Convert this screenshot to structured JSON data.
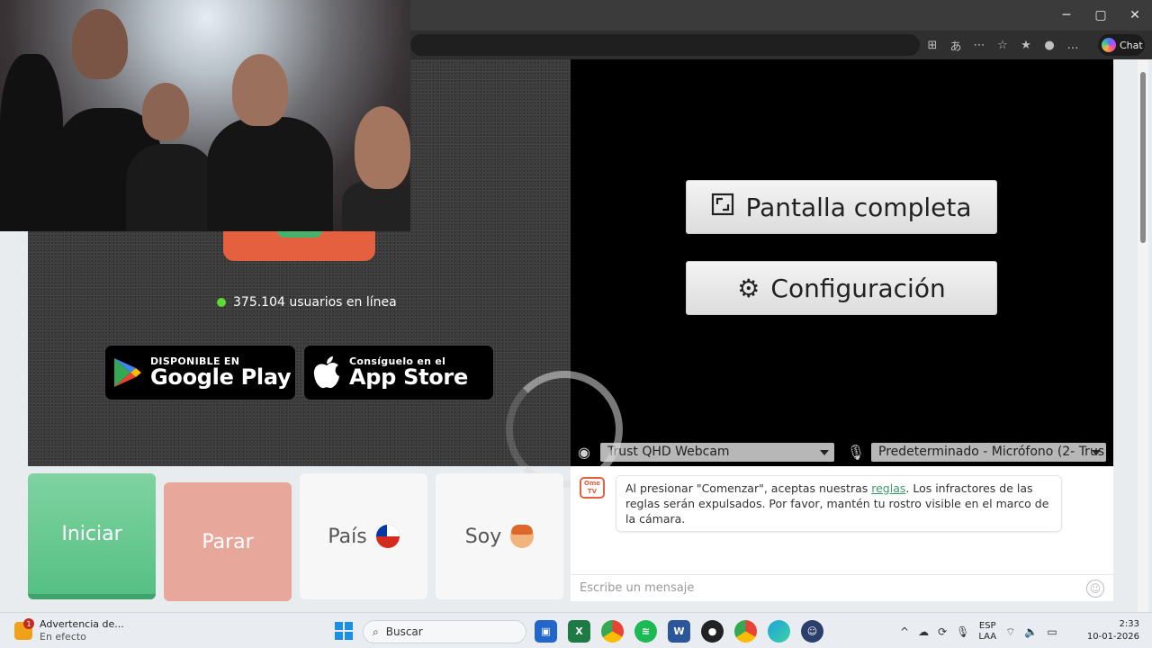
{
  "browser": {
    "window_controls": [
      "─",
      "▢",
      "✕"
    ],
    "copilot_label": "Chat"
  },
  "left_panel": {
    "online_count_text": "375.104 usuarios en línea",
    "google_play": {
      "small": "DISPONIBLE EN",
      "big": "Google Play"
    },
    "app_store": {
      "small": "Consíguelo en el",
      "big": "App Store"
    }
  },
  "right_panel": {
    "fullscreen_label": "Pantalla completa",
    "settings_label": "Configuración",
    "camera_select": "Trust QHD Webcam",
    "mic_select": "Predeterminado - Micrófono (2- Trus"
  },
  "controls": {
    "start": "Iniciar",
    "stop": "Parar",
    "country": "País",
    "gender": "Soy"
  },
  "chat": {
    "logo_text": "Ome TV",
    "message_before_link": "Al presionar \"Comenzar\", aceptas nuestras ",
    "message_link": "reglas",
    "message_after_link": ". Los infractores de las reglas serán expulsados. Por favor, mantén tu rostro visible en el marco de la cámara.",
    "input_placeholder": "Escribe un mensaje"
  },
  "taskbar": {
    "warning_title": "Advertencia de...",
    "warning_sub": "En efecto",
    "warning_badge": "1",
    "search_label": "Buscar",
    "lang_top": "ESP",
    "lang_bottom": "LAA",
    "time": "2:33",
    "date": "10-01-2026"
  },
  "colors": {
    "start_green": "#56c084",
    "stop_salmon": "#e8a79b",
    "brand_orange": "#e5603f",
    "online_green": "#5dd92f"
  }
}
